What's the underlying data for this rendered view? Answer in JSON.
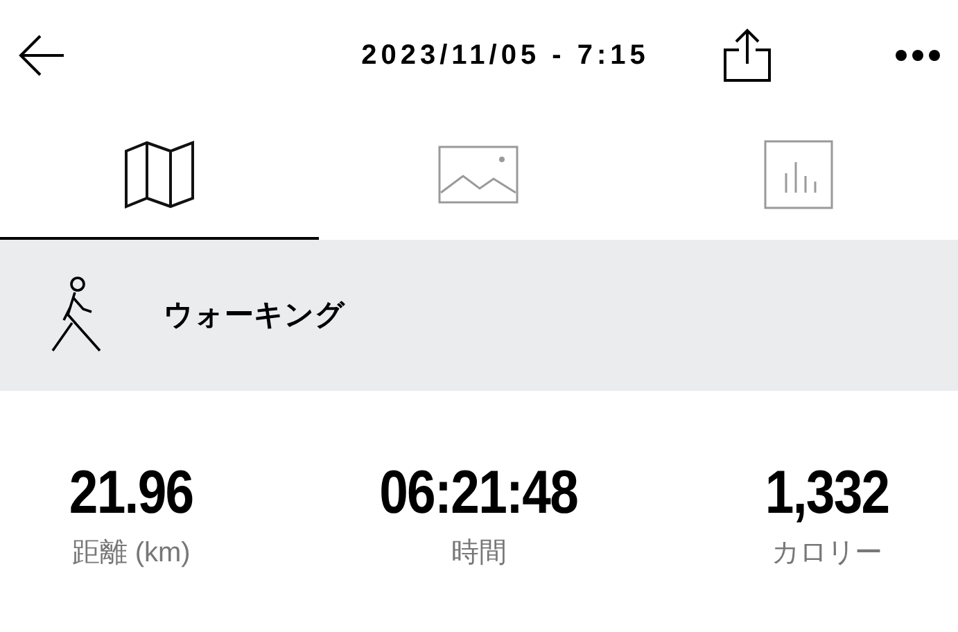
{
  "header": {
    "title": "2023/11/05 - 7:15"
  },
  "tabs": [
    {
      "kind": "map",
      "selected": true
    },
    {
      "kind": "photo",
      "selected": false
    },
    {
      "kind": "chart",
      "selected": false
    }
  ],
  "activity": {
    "name": "ウォーキング"
  },
  "stats": [
    {
      "value": "21.96",
      "label": "距離 (km)"
    },
    {
      "value": "06:21:48",
      "label": "時間"
    },
    {
      "value": "1,332",
      "label": "カロリー"
    }
  ]
}
